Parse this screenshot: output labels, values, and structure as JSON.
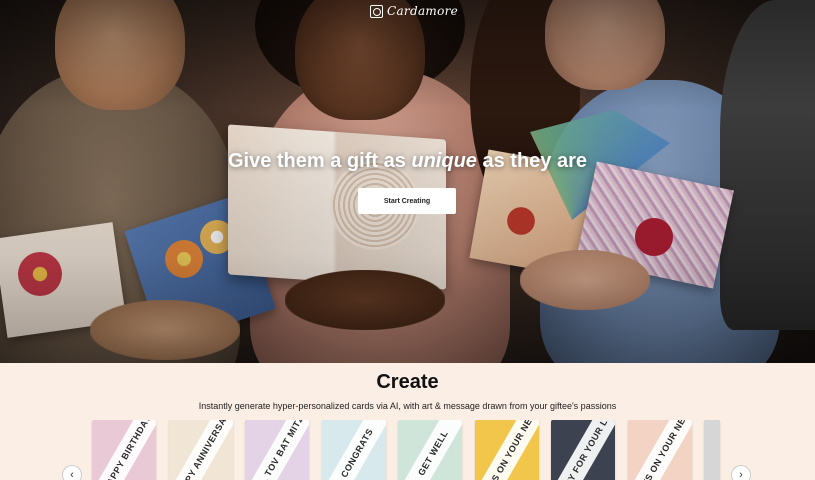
{
  "brand": {
    "name": "Cardamore"
  },
  "hero": {
    "headline_before": "Give them a gift as ",
    "headline_em": "unique",
    "headline_after": " as they are",
    "cta_label": "Start Creating"
  },
  "create": {
    "title": "Create",
    "subtitle": "Instantly generate hyper-personalized cards via AI, with art & message drawn from your giftee's passions",
    "cards": [
      {
        "label": "HAPPY BIRTHDAY",
        "bg": "#e9c9d6"
      },
      {
        "label": "HAPPY ANNIVERSARY",
        "bg": "#f1e6d6"
      },
      {
        "label": "MAZEL TOV BAT MITZVAH",
        "bg": "#e4d2e6"
      },
      {
        "label": "CONGRATS",
        "bg": "#d8e9ee"
      },
      {
        "label": "GET WELL",
        "bg": "#cfe5d9"
      },
      {
        "label": "CONGRATS ON YOUR NEW HOME",
        "bg": "#f2c64a"
      },
      {
        "label": "SORRY FOR YOUR LOSS",
        "bg": "#3c4250"
      },
      {
        "label": "CONGRATS ON YOUR NEW BABY",
        "bg": "#f3d3c3"
      },
      {
        "label": "",
        "bg": "#d6d6d6"
      }
    ],
    "prev_arrow": "‹",
    "next_arrow": "›"
  }
}
